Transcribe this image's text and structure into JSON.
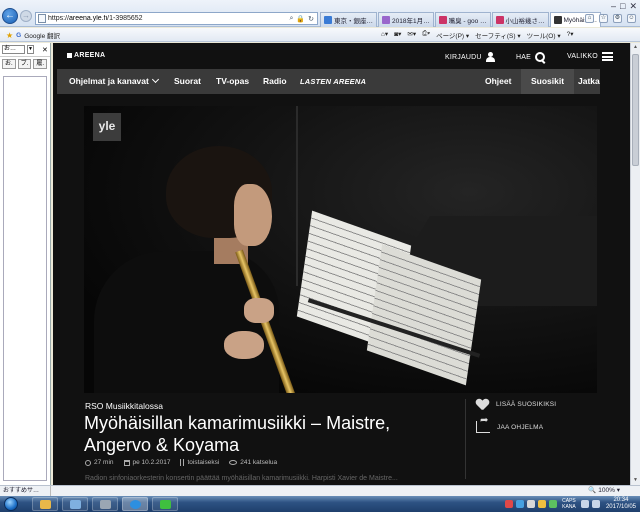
{
  "browser": {
    "url_prefix": "https://",
    "url_domain": "areena.yle.fi",
    "url_path": "/1-3985652",
    "tabs": [
      {
        "label": "東京・銀座…",
        "color": "#3a7bd5",
        "active": false
      },
      {
        "label": "2018年1月…",
        "color": "#9966cc",
        "active": false
      },
      {
        "label": "嘴臭 - goo …",
        "color": "#cc3366",
        "active": false
      },
      {
        "label": "小山裕幾さ…",
        "color": "#cc3366",
        "active": false
      },
      {
        "label": "Myöhäisil…",
        "color": "#333333",
        "active": true
      }
    ],
    "google_translate": "Google 翻訳",
    "command_bar": [
      "ページ(P) ▾",
      "セーフティ(S) ▾",
      "ツール(O) ▾"
    ],
    "side_panel": {
      "select_value": "お…",
      "buttons": [
        "お.",
        "ブ.",
        "履."
      ]
    },
    "status_left": "おすすめサ…",
    "zoom": "100%"
  },
  "site": {
    "logo": "AREENA",
    "header": {
      "login": "KIRJAUDU",
      "search": "HAE",
      "menu": "VALIKKO"
    },
    "nav": {
      "left": [
        "Ohjelmat ja kanavat",
        "Suorat",
        "TV-opas",
        "Radio",
        "LASTEN AREENA"
      ],
      "right": [
        "Ohjeet",
        "Suosikit",
        "Jatka"
      ]
    },
    "video": {
      "channel_logo": "yle"
    },
    "program": {
      "kicker": "RSO Musiikkitalossa",
      "title": "Myöhäisillan kamarimusiikki – Maistre, Angervo & Koyama",
      "duration": "27 min",
      "date": "pe 10.2.2017",
      "availability": "toistaiseksi",
      "views": "241 katselua",
      "description": "Radion sinfoniaorkesterin konsertin päättää myöhäisillan kamarimusiikki. Harpisti Xavier de Maistre..."
    },
    "actions": {
      "favorite": "LISÄÄ SUOSIKIKSI",
      "share": "JAA OHJELMA"
    }
  },
  "taskbar": {
    "time": "20:34",
    "date": "2017/10/05",
    "lang": "CAPS KANA"
  },
  "colors": {
    "nav_bg": "#3a3a3a",
    "page_bg": "#111111",
    "taskbar": "#2d5283"
  }
}
